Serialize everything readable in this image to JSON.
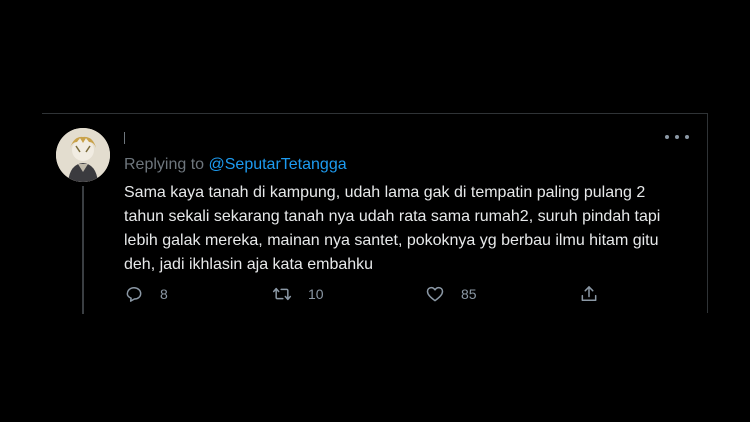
{
  "tweet": {
    "avatar_alt": "avatar",
    "replying_prefix": "Replying to ",
    "replying_handle": "@SeputarTetangga",
    "text": "Sama kaya tanah di kampung, udah lama gak di tempatin paling pulang 2 tahun sekali sekarang tanah nya udah rata sama rumah2, suruh pindah tapi lebih galak mereka, mainan nya santet, pokoknya yg berbau ilmu hitam gitu deh, jadi ikhlasin aja kata embahku",
    "actions": {
      "reply_count": "8",
      "retweet_count": "10",
      "like_count": "85"
    }
  },
  "colors": {
    "background": "#000000",
    "text": "#e7e9ea",
    "secondary": "#6e767d",
    "accent": "#1d9bf0",
    "border": "#2f3336"
  },
  "icons": [
    "more-icon",
    "reply-icon",
    "retweet-icon",
    "like-icon",
    "share-icon"
  ]
}
